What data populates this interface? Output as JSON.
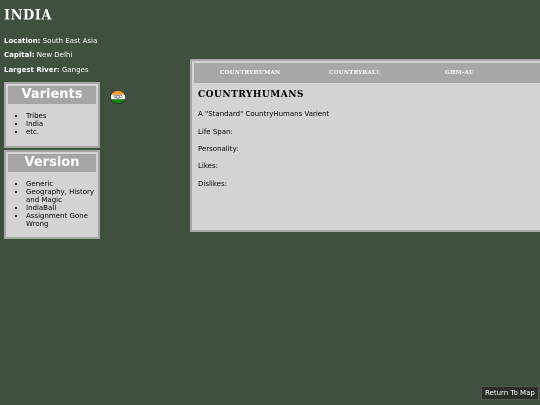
{
  "country": {
    "name": "INDIA",
    "location_label": "Location:",
    "location_value": "South East Asia",
    "capital_label": "Capital:",
    "capital_value": "New Delhi",
    "river_label": "Largest River:",
    "river_value": "Ganges"
  },
  "variants": {
    "heading": "Varients",
    "items": [
      "Tribes",
      "India",
      "etc."
    ]
  },
  "version": {
    "heading": "Version",
    "items": [
      "Generic",
      "Geography, History and Magic",
      "IndiaBall",
      "Assignment Gone Wrong"
    ]
  },
  "tabs": [
    {
      "label": "COUNTRYHUMAN"
    },
    {
      "label": "COUNTRYBALL"
    },
    {
      "label": "GHM-AU"
    }
  ],
  "content": {
    "title": "COUNTRYHUMANS",
    "description": "A \"Standard\" CountryHumans Varient",
    "life_span_label": "Life Span:",
    "personality_label": "Personality:",
    "likes_label": "Likes:",
    "dislikes_label": "Dislikes:"
  },
  "footer": {
    "return_label": "Return To Map"
  },
  "colors": {
    "background": "#40503e",
    "panel": "#d3d3d3",
    "panel_border": "#a7a7a7",
    "saffron": "#ff9933",
    "green": "#138808",
    "navy": "#000080"
  },
  "icons": {
    "flag_ball": "india-countryball-icon"
  }
}
